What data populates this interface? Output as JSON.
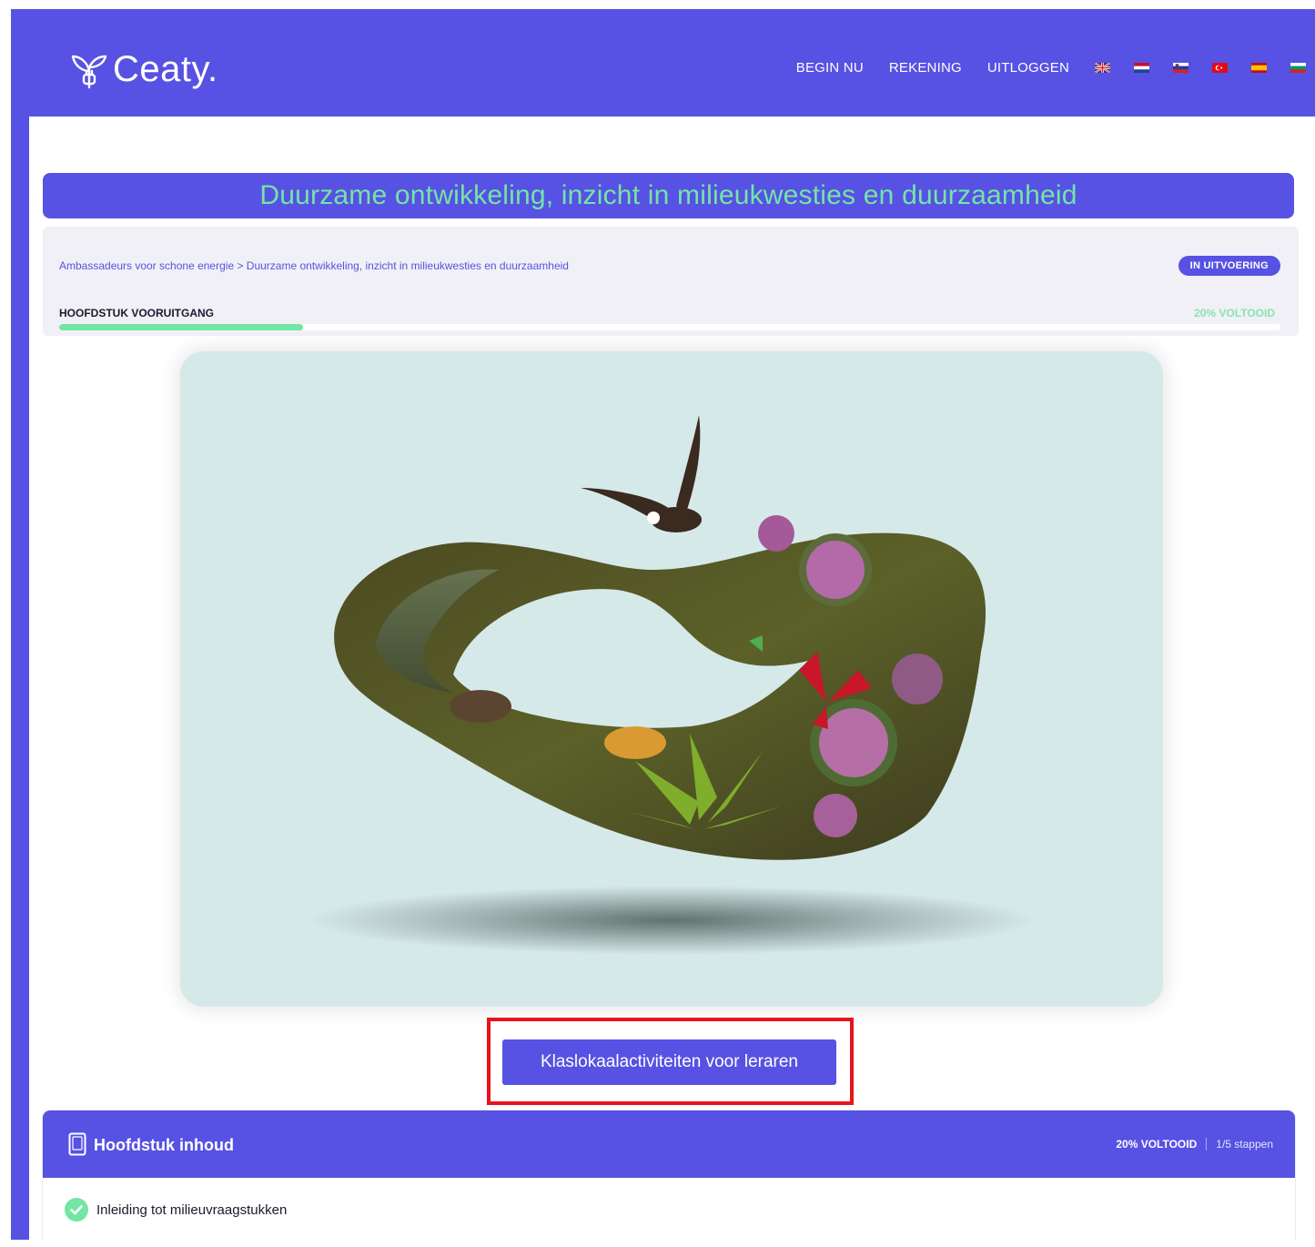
{
  "header": {
    "logo_text": "Ceaty.",
    "nav": [
      "BEGIN NU",
      "REKENING",
      "UITLOGGEN"
    ],
    "flags": [
      "en-flag-icon",
      "nl-flag-icon",
      "si-flag-icon",
      "tr-flag-icon",
      "es-flag-icon",
      "bg-flag-icon"
    ]
  },
  "page": {
    "title": "Duurzame ontwikkeling, inzicht in milieukwesties en duurzaamheid"
  },
  "progress": {
    "breadcrumb": "Ambassadeurs voor schone energie > Duurzame ontwikkeling, inzicht in milieukwesties en duurzaamheid",
    "status": "IN UITVOERING",
    "label": "HOOFDSTUK VOORUITGANG",
    "percent_text": "20% VOLTOOID",
    "percent_value": 0.2
  },
  "hero": {
    "image": "mobius-strip-nature-illustration"
  },
  "cta": {
    "label": "Klaslokaalactiviteiten voor leraren"
  },
  "chapter": {
    "title": "Hoofdstuk inhoud",
    "percent_text": "20% VOLTOOID",
    "steps_text": "1/5 stappen",
    "lessons": [
      {
        "label": "Inleiding tot milieuvraagstukken",
        "completed": true
      }
    ]
  },
  "colors": {
    "brand": "#5752e3",
    "accent": "#73e5a5",
    "highlight": "#e8131b"
  }
}
